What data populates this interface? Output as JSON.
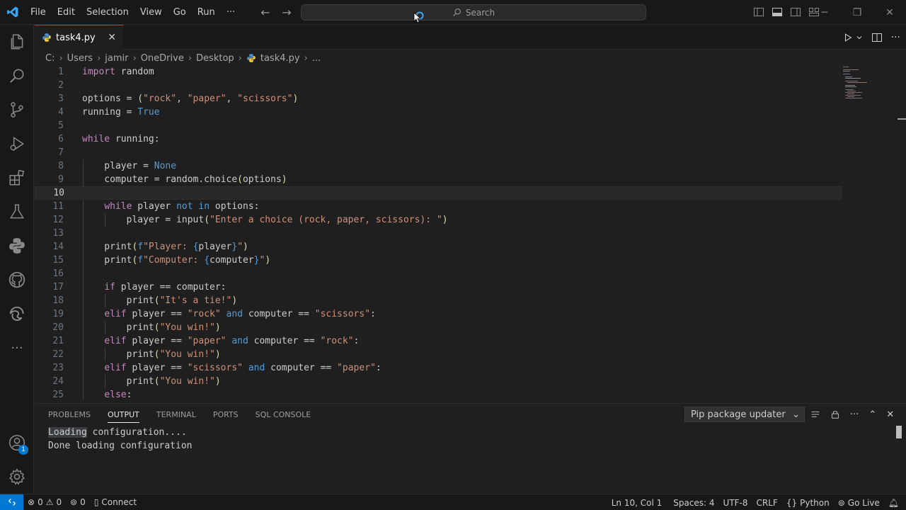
{
  "titlebar": {
    "menu": [
      "File",
      "Edit",
      "Selection",
      "View",
      "Go",
      "Run",
      "···"
    ],
    "search_placeholder": "Search"
  },
  "tab": {
    "filename": "task4.py"
  },
  "breadcrumb": [
    "C:",
    "Users",
    "jamir",
    "OneDrive",
    "Desktop",
    "task4.py",
    "..."
  ],
  "editor": {
    "line_numbers": [
      "1",
      "2",
      "3",
      "4",
      "5",
      "6",
      "7",
      "8",
      "9",
      "10",
      "11",
      "12",
      "13",
      "14",
      "15",
      "16",
      "17",
      "18",
      "19",
      "20",
      "21",
      "22",
      "23",
      "24",
      "25"
    ],
    "active_line": 10
  },
  "panel": {
    "tabs": [
      "PROBLEMS",
      "OUTPUT",
      "TERMINAL",
      "PORTS",
      "SQL CONSOLE"
    ],
    "active_tab": "OUTPUT",
    "output_channel": "Pip package updater",
    "output_first_word": "Loading",
    "output_first_rest": " configuration....",
    "output_second": "Done loading configuration"
  },
  "activity": {
    "account_badge": "1"
  },
  "statusbar": {
    "errors": "0",
    "warnings": "0",
    "ports": "0",
    "connect": "Connect",
    "position": "Ln 10, Col 1",
    "spaces": "Spaces: 4",
    "encoding": "UTF-8",
    "eol": "CRLF",
    "language": "Python",
    "golive": "Go Live"
  },
  "colors": {
    "accent": "#0078d4",
    "background": "#1f1f1f",
    "keyword": "#c586c0",
    "constant": "#569cd6",
    "string": "#ce9178",
    "function": "#dcdcaa"
  }
}
